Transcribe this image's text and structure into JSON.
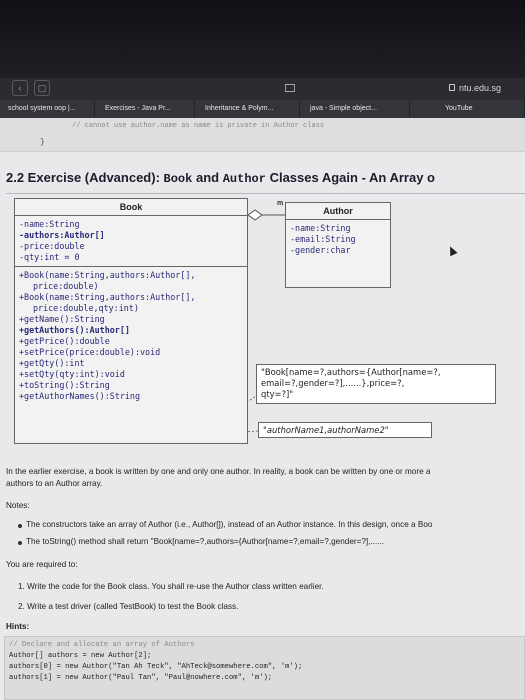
{
  "browser": {
    "url": "ntu.edu.sg",
    "tabs": [
      "school system oop |...",
      "Exercises - Java Pr...",
      "Inheritance & Polym...",
      "java - Simple object...",
      "YouTube"
    ]
  },
  "code_top": {
    "comment": "// cannot use author.name as name is private in Author class",
    "brace": "}"
  },
  "heading": {
    "prefix": "2.2 Exercise (Advanced):",
    "book": "Book",
    "and": "and",
    "author": "Author",
    "suffix": "Classes Again - An Array o"
  },
  "uml": {
    "assoc_label": "m",
    "book": {
      "title": "Book",
      "fields": [
        "-name:String",
        "-authors:Author[]",
        "-price:double",
        "-qty:int = 0"
      ],
      "methods": [
        "+Book(name:String,authors:Author[],",
        "price:double)",
        "+Book(name:String,authors:Author[],",
        "price:double,qty:int)",
        "+getName():String",
        "+getAuthors():Author[]",
        "+getPrice():double",
        "+setPrice(price:double):void",
        "+getQty():int",
        "+setQty(qty:int):void",
        "+toString():String",
        "+getAuthorNames():String"
      ]
    },
    "author": {
      "title": "Author",
      "fields": [
        "-name:String",
        "-email:String",
        "-gender:char"
      ]
    },
    "note_tostring": [
      "\"Book[name=?,authors={Author[name=?,",
      "email=?,gender=?],......},price=?,",
      "qty=?]\""
    ],
    "note_names": "\"authorName1,authorName2\""
  },
  "prose": {
    "line1": "In the earlier exercise, a book is written by one and only one author. In reality, a book can be written by one or more a",
    "line1_link": "earlier exercise",
    "line2": "authors to an Author array.",
    "notes_label": "Notes:",
    "bullet1": "The constructors take an array of Author (i.e., Author[]), instead of an Author instance. In this design, once a Boo",
    "bullet2": "The toString() method shall return \"Book[name=?,authors={Author[name=?,email=?,gender=?],......",
    "required": "You are required to:",
    "req1": "1.  Write the code for the Book class. You shall re-use the Author class written earlier.",
    "req2": "2.  Write a test driver (called TestBook) to test the Book class.",
    "hints": "Hints:"
  },
  "hints_code": [
    "// Declare and allocate an array of Authors",
    "Author[] authors = new Author[2];",
    "authors[0] = new Author(\"Tan Ah Teck\", \"AhTeck@somewhere.com\", 'm');",
    "authors[1] = new Author(\"Paul Tan\", \"Paul@nowhere.com\", 'm');"
  ]
}
